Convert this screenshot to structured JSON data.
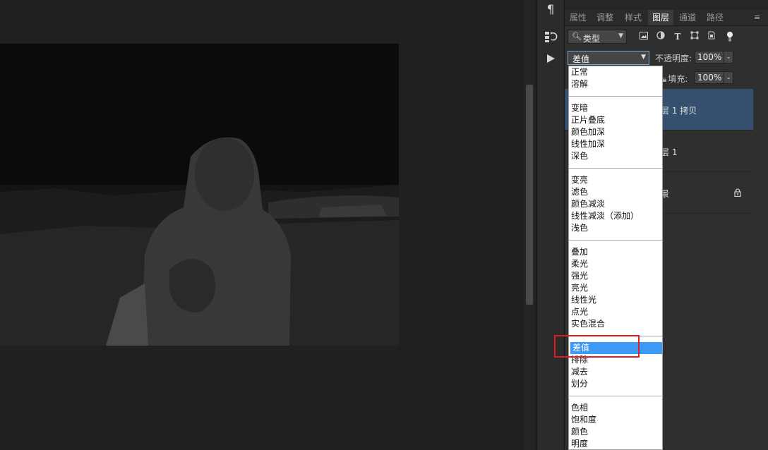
{
  "colors": {
    "selection_blue": "#3c99f5",
    "layer_selected": "#34506e",
    "highlight_red": "#e01b24"
  },
  "tool_strip": [
    "paragraph-icon",
    "history-icon",
    "play-icon"
  ],
  "panel": {
    "tabs": [
      "属性",
      "调整",
      "样式",
      "图层",
      "通道",
      "路径"
    ],
    "active_tab": "图层",
    "filter": {
      "value": "类型",
      "icons": [
        "image-filter-icon",
        "adjustment-filter-icon",
        "type-filter-icon",
        "shape-filter-icon",
        "smart-object-filter-icon",
        "toggle-filter-icon"
      ]
    },
    "blend_mode": "差值",
    "opacity_label": "不透明度:",
    "opacity_value": "100%",
    "lock_label_partial": "",
    "fill_label": "填充:",
    "fill_value": "100%",
    "layers": [
      {
        "name": "层 1 拷贝",
        "selected": true
      },
      {
        "name": "层 1",
        "selected": false
      },
      {
        "name": "景",
        "selected": false,
        "locked": true
      }
    ]
  },
  "blend_groups": [
    [
      "正常",
      "溶解"
    ],
    [
      "变暗",
      "正片叠底",
      "颜色加深",
      "线性加深",
      "深色"
    ],
    [
      "变亮",
      "滤色",
      "颜色减淡",
      "线性减淡（添加）",
      "浅色"
    ],
    [
      "叠加",
      "柔光",
      "强光",
      "亮光",
      "线性光",
      "点光",
      "实色混合"
    ],
    [
      "差值",
      "排除",
      "减去",
      "划分"
    ],
    [
      "色相",
      "饱和度",
      "颜色",
      "明度"
    ]
  ],
  "selected_blend": "差值"
}
